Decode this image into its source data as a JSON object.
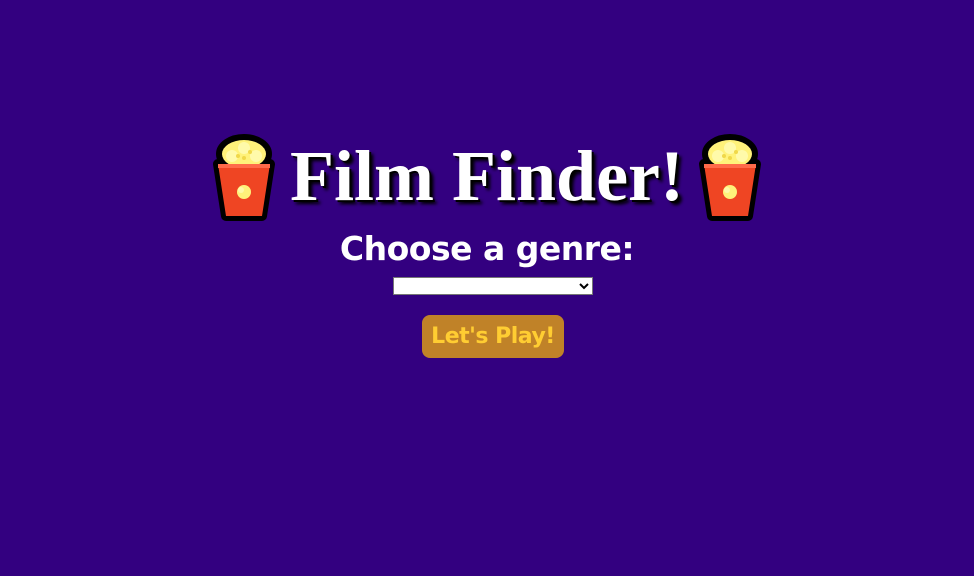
{
  "header": {
    "title": "Film Finder!",
    "left_icon": "popcorn-icon",
    "right_icon": "popcorn-icon"
  },
  "genre": {
    "label": "Choose a genre:",
    "selected": ""
  },
  "play_button": {
    "label": "Let's Play!"
  },
  "colors": {
    "background": "#330080",
    "title": "#ffffff",
    "button_bg": "#c08228",
    "button_text": "#ffcd32",
    "popcorn_box": "#ef4523",
    "popcorn_kernel": "#fff27a"
  }
}
